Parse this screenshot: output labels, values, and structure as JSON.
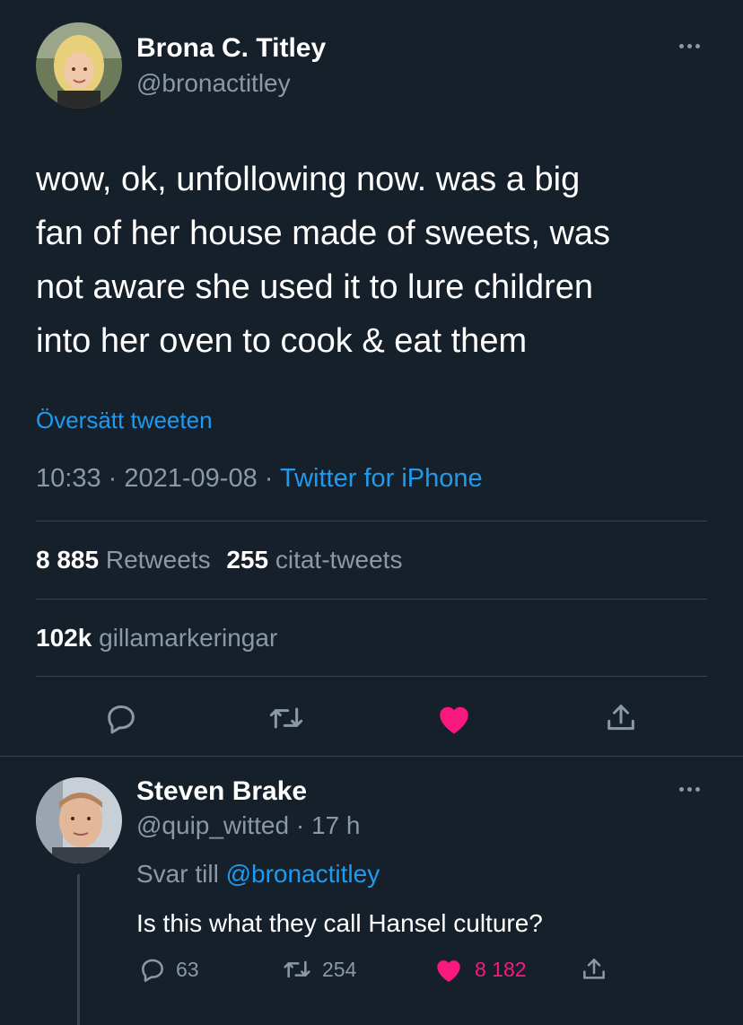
{
  "tweet": {
    "author_name": "Brona C. Titley",
    "author_handle": "@bronactitley",
    "text_lines": [
      "wow, ok, unfollowing now. was a big",
      "fan of her house made of sweets, was",
      "not aware she used it to lure children",
      "into her oven to cook & eat them"
    ],
    "translate": "Översätt tweeten",
    "time": "10:33",
    "date": "2021-09-08",
    "separator": "·",
    "source": "Twitter for iPhone",
    "retweets_count": "8 885",
    "retweets_label": "Retweets",
    "quotes_count": "255",
    "quotes_label": "citat-tweets",
    "likes_count": "102k",
    "likes_label": "gillamarkeringar"
  },
  "reply": {
    "author_name": "Steven Brake",
    "author_handle": "@quip_witted",
    "time": "17 h",
    "separator": "·",
    "reply_prefix": "Svar till",
    "reply_to": "@bronactitley",
    "text": "Is this what they call Hansel culture?",
    "reply_count": "63",
    "retweet_count": "254",
    "like_count": "8 182"
  },
  "icons": {
    "more": "more-horizontal-icon",
    "reply": "reply-icon",
    "retweet": "retweet-icon",
    "like": "heart-icon",
    "share": "share-icon"
  },
  "colors": {
    "background": "#15202b",
    "link": "#1d9bf0",
    "muted": "#8b98a5",
    "like": "#f91880",
    "divider": "#38444d"
  }
}
